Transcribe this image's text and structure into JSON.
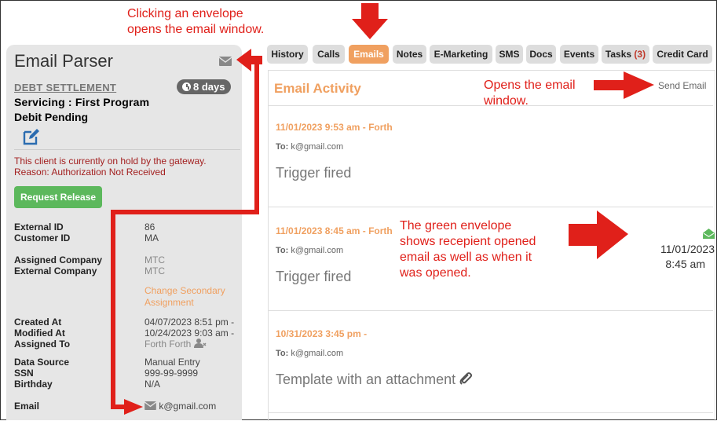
{
  "annotations": {
    "top_left": [
      "Clicking an envelope",
      "opens the email window."
    ],
    "send_email": [
      "Opens the email",
      "window."
    ],
    "green_envelope": [
      "The green envelope",
      "shows recepient opened",
      "email as well as when it",
      "was opened."
    ]
  },
  "left_panel": {
    "title": "Email Parser",
    "section": "DEBT SETTLEMENT",
    "days_badge": "8 days",
    "servicing": "Servicing : First Program",
    "status": "Debit Pending",
    "hold_line1": "This client is currently on hold by the gateway.",
    "hold_line2": "Reason: Authorization Not Received",
    "release_button": "Request Release",
    "fields": [
      {
        "label": "External ID",
        "value": "86"
      },
      {
        "label": "Customer ID",
        "value": "MA"
      },
      {
        "label": "Assigned Company",
        "value": "MTC"
      },
      {
        "label": "External Company",
        "value": "MTC"
      },
      {
        "label": "Change Secondary Assignment",
        "value": "Change Secondary"
      },
      {
        "label": "",
        "value": "Assignment"
      },
      {
        "label": "Created At",
        "value": "04/07/2023 8:51 pm -"
      },
      {
        "label": "Modified At",
        "value": "10/24/2023 9:03 am -"
      },
      {
        "label": "Assigned To",
        "value": "Forth Forth"
      },
      {
        "label": "Data Source",
        "value": "Manual Entry"
      },
      {
        "label": "SSN",
        "value": "999-99-9999"
      },
      {
        "label": "Birthday",
        "value": "N/A"
      },
      {
        "label": "Email",
        "value": "k@gmail.com"
      }
    ]
  },
  "tabs": [
    {
      "label": "History"
    },
    {
      "label": "Calls"
    },
    {
      "label": "Emails"
    },
    {
      "label": "Notes"
    },
    {
      "label": "E-Marketing"
    },
    {
      "label": "SMS"
    },
    {
      "label": "Docs"
    },
    {
      "label": "Events"
    },
    {
      "label": "Tasks",
      "count": "(3)"
    },
    {
      "label": "Credit Card"
    }
  ],
  "activity": {
    "title": "Email Activity",
    "send_email": "Send Email",
    "to_label": "To:",
    "emails": [
      {
        "date": "11/01/2023 9:53 am - Forth",
        "to": "k@gmail.com",
        "subject": "Trigger fired"
      },
      {
        "date": "11/01/2023 8:45 am - Forth",
        "to": "k@gmail.com",
        "subject": "Trigger fired",
        "opened_date": "11/01/2023",
        "opened_time": "8:45 am"
      },
      {
        "date": "10/31/2023 3:45 pm -",
        "to": "k@gmail.com",
        "subject": "Template with an attachment"
      }
    ]
  },
  "colors": {
    "accent": "#f0a060",
    "annotation": "#e0201a",
    "opened": "#5cb85c",
    "hold": "#a32020"
  }
}
